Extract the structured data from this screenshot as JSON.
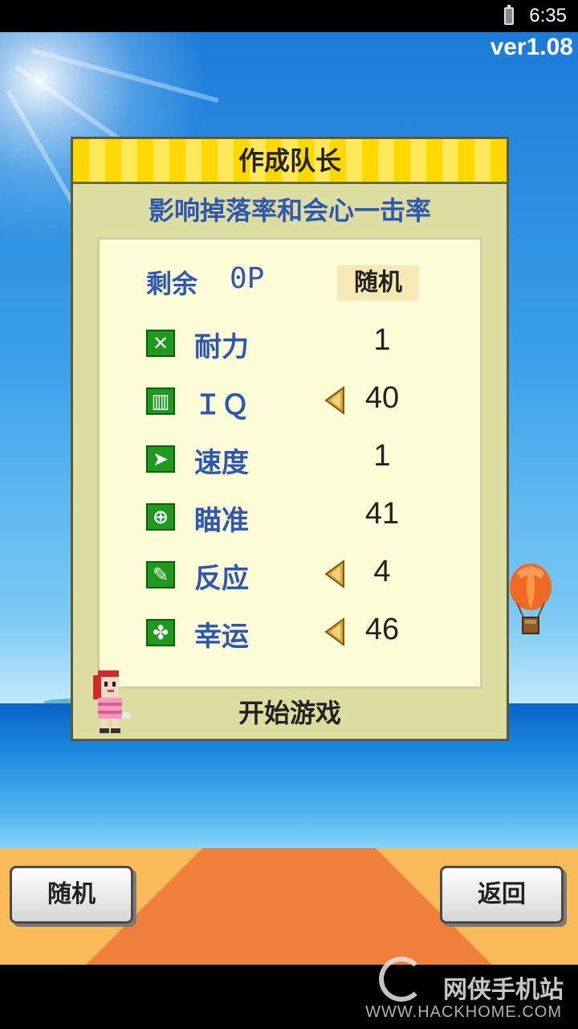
{
  "status_bar": {
    "time": "6:35"
  },
  "version": "ver1.08",
  "dialog": {
    "title": "作成队长",
    "subtitle": "影响掉落率和会心一击率",
    "remaining_label": "剩余",
    "remaining_value": "0P",
    "random_label": "随机",
    "stats": [
      {
        "icon": "stamina-icon",
        "label": "耐力",
        "value": "1",
        "has_arrow": false
      },
      {
        "icon": "iq-book-icon",
        "label": "ＩＱ",
        "value": "40",
        "has_arrow": true
      },
      {
        "icon": "speed-icon",
        "label": "速度",
        "value": "1",
        "has_arrow": false
      },
      {
        "icon": "aim-crosshair-icon",
        "label": "瞄准",
        "value": "41",
        "has_arrow": false
      },
      {
        "icon": "reaction-icon",
        "label": "反应",
        "value": "4",
        "has_arrow": true
      },
      {
        "icon": "luck-clover-icon",
        "label": "幸运",
        "value": "46",
        "has_arrow": true
      }
    ],
    "start_label": "开始游戏"
  },
  "bottom_bar": {
    "random_button": "随机",
    "back_button": "返回"
  },
  "watermark": {
    "brand": "网侠手机站",
    "url": "WWW.HACKHOME.COM"
  },
  "colors": {
    "accent_blue": "#2d57b0",
    "header_yellow": "#ffd800",
    "icon_green": "#1f9a1f"
  }
}
